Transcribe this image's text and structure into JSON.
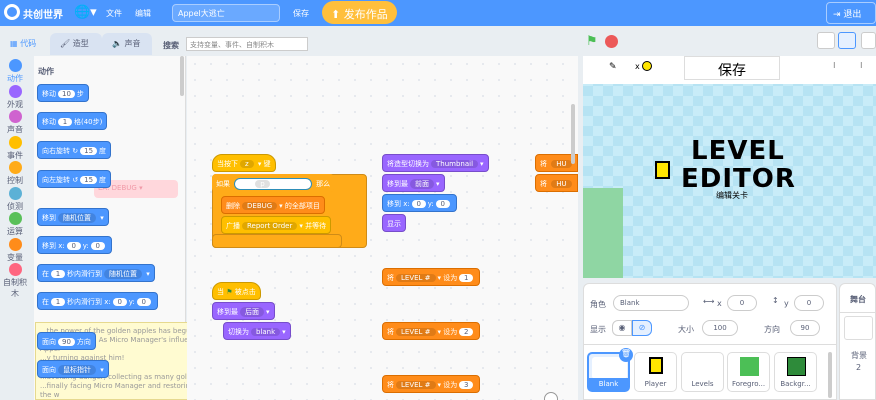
{
  "menu": {
    "brand": "共创世界",
    "file": "文件",
    "edit": "编辑",
    "project_title": "Appel大逃亡",
    "save": "保存",
    "publish": "发布作品",
    "exit": "退出"
  },
  "tabs": {
    "code": "代码",
    "costume": "造型",
    "sound": "声音",
    "search_label": "搜索",
    "search_placeholder": "支持变量、事件、自制积木"
  },
  "categories": [
    "动作",
    "外观",
    "声音",
    "事件",
    "控制",
    "侦测",
    "运算",
    "变量",
    "自制积木"
  ],
  "category_colors": [
    "#4c97ff",
    "#9966ff",
    "#cf63cf",
    "#ffbf00",
    "#ffab19",
    "#5cb1d6",
    "#59c059",
    "#ff8c1a",
    "#ff6680"
  ],
  "palette": {
    "heading": "动作",
    "move": {
      "a": "移动",
      "v": "10",
      "b": "步"
    },
    "move_grid": {
      "a": "移动",
      "v": "1",
      "b": "格(40步)"
    },
    "turn_right": {
      "a": "向右旋转",
      "v": "15",
      "b": "度"
    },
    "turn_left": {
      "a": "向左旋转",
      "v": "15",
      "b": "度"
    },
    "goto": {
      "a": "移到",
      "v": "随机位置"
    },
    "goto_xy": {
      "a": "移到 x:",
      "x": "0",
      "b": "y:",
      "y": "0"
    },
    "glide": {
      "a": "在",
      "v": "1",
      "b": "秒内滑行到",
      "c": "随机位置"
    },
    "glide_xy": {
      "a": "在",
      "v": "1",
      "b": "秒内滑行到 x:",
      "x": "0",
      "c": "y:",
      "y": "0"
    },
    "point_dir": {
      "a": "面向",
      "v": "90",
      "b": "方向"
    },
    "point_to": {
      "a": "面向",
      "v": "鼠标指针"
    },
    "ghost_debug": "DEBUG"
  },
  "tooltip": {
    "line1": "...the power of the golden apples has begun t",
    "line2": "...permacheaps. As Micro Manager's influence grows, Appel",
    "line3": "...y turning against him!",
    "line4": "...avoiding danger, collecting as many golde",
    "line5": "...finally facing Micro Manager and restoring peace to the w",
    "close": "×"
  },
  "scripts": {
    "when_key": {
      "a": "当按下",
      "k": "z",
      "b": "键"
    },
    "if_key": {
      "a": "如果",
      "b": "按键",
      "k": "p",
      "c": "是否按下?",
      "d": "那么"
    },
    "delete_all": {
      "a": "删除",
      "v": "DEBUG",
      "b": "的全部项目"
    },
    "broadcast": {
      "a": "广播",
      "v": "Report Order",
      "b": "并等待"
    },
    "when_flag": {
      "a": "当",
      "b": "被点击"
    },
    "goto_layer": {
      "a": "移到最",
      "v": "后面"
    },
    "switch_costume": {
      "a": "切换为",
      "v": "blank"
    },
    "costume_switch": {
      "a": "将造型切换为",
      "v": "Thumbnail"
    },
    "goto_front": {
      "a": "移到最",
      "v": "前面"
    },
    "goto_xy": {
      "a": "移到 x:",
      "x": "0",
      "b": "y:",
      "y": "0"
    },
    "show": "显示",
    "set1": {
      "a": "将",
      "v": "LEVEL #",
      "b": "设为",
      "n": "1"
    },
    "set2": {
      "a": "将",
      "v": "LEVEL #",
      "b": "设为",
      "n": "2"
    },
    "set3": {
      "a": "将",
      "v": "LEVEL #",
      "b": "设为",
      "n": "3"
    },
    "partial1": "将",
    "partial1b": "HU",
    "partial2": "将",
    "partial2b": "HU"
  },
  "stage": {
    "save_label": "保存",
    "title1": "LEVEL",
    "title2": "EDITOR",
    "subtitle": "编辑关卡",
    "x_label": "x"
  },
  "sprite": {
    "label": "角色",
    "name": "Blank",
    "x_label": "x",
    "x": "0",
    "y_label": "y",
    "y": "0",
    "show_label": "显示",
    "size_label": "大小",
    "size": "100",
    "dir_label": "方向",
    "dir": "90"
  },
  "sprites": [
    "Blank",
    "Player",
    "Levels",
    "Foregro...",
    "Backgr..."
  ],
  "stage_pane": {
    "title": "舞台",
    "backdrops_label": "背景",
    "backdrops_count": "2"
  }
}
